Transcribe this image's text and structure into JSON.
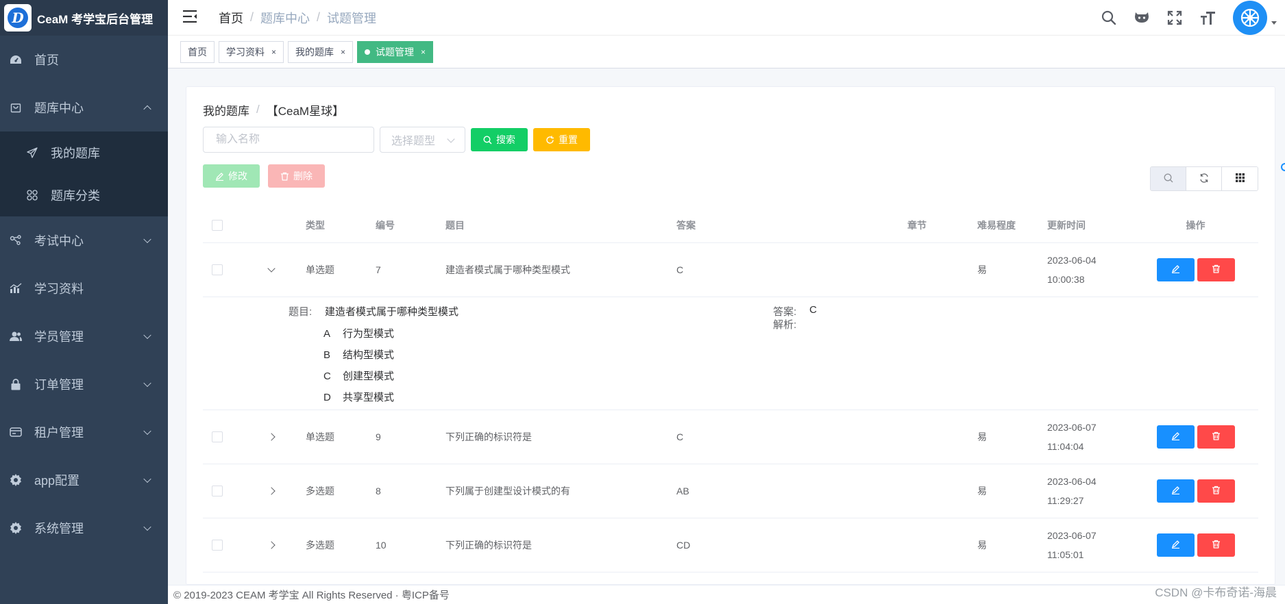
{
  "app": {
    "title": "CeaM 考学宝后台管理",
    "logo_letter": "D"
  },
  "sidebar": {
    "items": [
      {
        "label": "首页",
        "icon": "dashboard-icon"
      },
      {
        "label": "题库中心",
        "icon": "shopping-bag-icon",
        "expanded": true,
        "children": [
          {
            "label": "我的题库",
            "icon": "send-icon"
          },
          {
            "label": "题库分类",
            "icon": "grid-icon"
          }
        ]
      },
      {
        "label": "考试中心",
        "icon": "share-icon"
      },
      {
        "label": "学习资料",
        "icon": "chart-icon"
      },
      {
        "label": "学员管理",
        "icon": "users-icon"
      },
      {
        "label": "订单管理",
        "icon": "lock-icon"
      },
      {
        "label": "租户管理",
        "icon": "card-icon"
      },
      {
        "label": "app配置",
        "icon": "gear-icon"
      },
      {
        "label": "系统管理",
        "icon": "gear-icon"
      }
    ]
  },
  "header": {
    "breadcrumb": [
      "首页",
      "题库中心",
      "试题管理"
    ]
  },
  "tags": [
    {
      "label": "首页",
      "closable": false,
      "active": false
    },
    {
      "label": "学习资料",
      "closable": true,
      "active": false
    },
    {
      "label": "我的题库",
      "closable": true,
      "active": false
    },
    {
      "label": "试题管理",
      "closable": true,
      "active": true
    }
  ],
  "page": {
    "crumb": [
      "我的题库",
      "【CeaM星球】"
    ],
    "search": {
      "name_placeholder": "输入名称",
      "type_placeholder": "选择题型"
    },
    "buttons": {
      "search": "搜索",
      "reset": "重置",
      "edit": "修改",
      "delete": "删除"
    }
  },
  "table": {
    "columns": [
      "类型",
      "编号",
      "题目",
      "答案",
      "章节",
      "难易程度",
      "更新时间",
      "操作"
    ],
    "rows": [
      {
        "type": "单选题",
        "num": "7",
        "title": "建造者模式属于哪种类型模式",
        "answer": "C",
        "chapter": "",
        "difficulty": "易",
        "date": "2023-06-04",
        "time": "10:00:38",
        "expanded": true
      },
      {
        "type": "单选题",
        "num": "9",
        "title": "下列正确的标识符是",
        "answer": "C",
        "chapter": "",
        "difficulty": "易",
        "date": "2023-06-07",
        "time": "11:04:04"
      },
      {
        "type": "多选题",
        "num": "8",
        "title": "下列属于创建型设计模式的有",
        "answer": "AB",
        "chapter": "",
        "difficulty": "易",
        "date": "2023-06-04",
        "time": "11:29:27"
      },
      {
        "type": "多选题",
        "num": "10",
        "title": "下列正确的标识符是",
        "answer": "CD",
        "chapter": "",
        "difficulty": "易",
        "date": "2023-06-07",
        "time": "11:05:01"
      }
    ],
    "expand": {
      "question_label": "题目:",
      "question": "建造者模式属于哪种类型模式",
      "options": [
        {
          "letter": "A",
          "text": "行为型模式"
        },
        {
          "letter": "B",
          "text": "结构型模式"
        },
        {
          "letter": "C",
          "text": "创建型模式"
        },
        {
          "letter": "D",
          "text": "共享型模式"
        }
      ],
      "answer_label": "答案:",
      "answer": "C",
      "analysis_label": "解析:"
    }
  },
  "footer": {
    "text": "© 2019-2023 CEAM 考学宝 All Rights Reserved · 粤ICP备号"
  },
  "watermark": "CSDN @卡布奇诺-海晨",
  "colors": {
    "sidebar": "#304156",
    "success": "#13ce66",
    "warning": "#ffba00",
    "primary": "#1890ff",
    "danger": "#ff4949",
    "tag_active": "#42b983"
  }
}
